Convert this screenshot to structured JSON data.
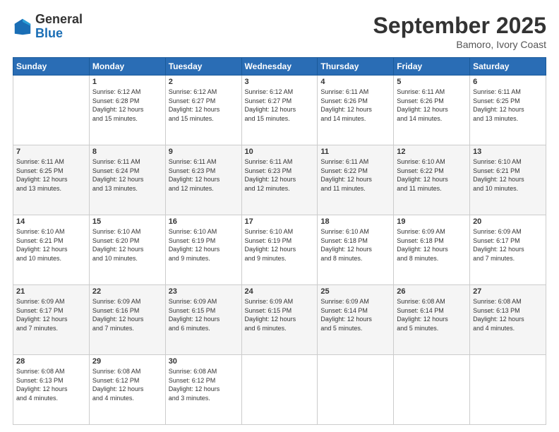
{
  "header": {
    "logo": {
      "line1": "General",
      "line2": "Blue"
    },
    "title": "September 2025",
    "location": "Bamoro, Ivory Coast"
  },
  "weekdays": [
    "Sunday",
    "Monday",
    "Tuesday",
    "Wednesday",
    "Thursday",
    "Friday",
    "Saturday"
  ],
  "weeks": [
    [
      {
        "day": "",
        "info": ""
      },
      {
        "day": "1",
        "info": "Sunrise: 6:12 AM\nSunset: 6:28 PM\nDaylight: 12 hours\nand 15 minutes."
      },
      {
        "day": "2",
        "info": "Sunrise: 6:12 AM\nSunset: 6:27 PM\nDaylight: 12 hours\nand 15 minutes."
      },
      {
        "day": "3",
        "info": "Sunrise: 6:12 AM\nSunset: 6:27 PM\nDaylight: 12 hours\nand 15 minutes."
      },
      {
        "day": "4",
        "info": "Sunrise: 6:11 AM\nSunset: 6:26 PM\nDaylight: 12 hours\nand 14 minutes."
      },
      {
        "day": "5",
        "info": "Sunrise: 6:11 AM\nSunset: 6:26 PM\nDaylight: 12 hours\nand 14 minutes."
      },
      {
        "day": "6",
        "info": "Sunrise: 6:11 AM\nSunset: 6:25 PM\nDaylight: 12 hours\nand 13 minutes."
      }
    ],
    [
      {
        "day": "7",
        "info": "Sunrise: 6:11 AM\nSunset: 6:25 PM\nDaylight: 12 hours\nand 13 minutes."
      },
      {
        "day": "8",
        "info": "Sunrise: 6:11 AM\nSunset: 6:24 PM\nDaylight: 12 hours\nand 13 minutes."
      },
      {
        "day": "9",
        "info": "Sunrise: 6:11 AM\nSunset: 6:23 PM\nDaylight: 12 hours\nand 12 minutes."
      },
      {
        "day": "10",
        "info": "Sunrise: 6:11 AM\nSunset: 6:23 PM\nDaylight: 12 hours\nand 12 minutes."
      },
      {
        "day": "11",
        "info": "Sunrise: 6:11 AM\nSunset: 6:22 PM\nDaylight: 12 hours\nand 11 minutes."
      },
      {
        "day": "12",
        "info": "Sunrise: 6:10 AM\nSunset: 6:22 PM\nDaylight: 12 hours\nand 11 minutes."
      },
      {
        "day": "13",
        "info": "Sunrise: 6:10 AM\nSunset: 6:21 PM\nDaylight: 12 hours\nand 10 minutes."
      }
    ],
    [
      {
        "day": "14",
        "info": "Sunrise: 6:10 AM\nSunset: 6:21 PM\nDaylight: 12 hours\nand 10 minutes."
      },
      {
        "day": "15",
        "info": "Sunrise: 6:10 AM\nSunset: 6:20 PM\nDaylight: 12 hours\nand 10 minutes."
      },
      {
        "day": "16",
        "info": "Sunrise: 6:10 AM\nSunset: 6:19 PM\nDaylight: 12 hours\nand 9 minutes."
      },
      {
        "day": "17",
        "info": "Sunrise: 6:10 AM\nSunset: 6:19 PM\nDaylight: 12 hours\nand 9 minutes."
      },
      {
        "day": "18",
        "info": "Sunrise: 6:10 AM\nSunset: 6:18 PM\nDaylight: 12 hours\nand 8 minutes."
      },
      {
        "day": "19",
        "info": "Sunrise: 6:09 AM\nSunset: 6:18 PM\nDaylight: 12 hours\nand 8 minutes."
      },
      {
        "day": "20",
        "info": "Sunrise: 6:09 AM\nSunset: 6:17 PM\nDaylight: 12 hours\nand 7 minutes."
      }
    ],
    [
      {
        "day": "21",
        "info": "Sunrise: 6:09 AM\nSunset: 6:17 PM\nDaylight: 12 hours\nand 7 minutes."
      },
      {
        "day": "22",
        "info": "Sunrise: 6:09 AM\nSunset: 6:16 PM\nDaylight: 12 hours\nand 7 minutes."
      },
      {
        "day": "23",
        "info": "Sunrise: 6:09 AM\nSunset: 6:15 PM\nDaylight: 12 hours\nand 6 minutes."
      },
      {
        "day": "24",
        "info": "Sunrise: 6:09 AM\nSunset: 6:15 PM\nDaylight: 12 hours\nand 6 minutes."
      },
      {
        "day": "25",
        "info": "Sunrise: 6:09 AM\nSunset: 6:14 PM\nDaylight: 12 hours\nand 5 minutes."
      },
      {
        "day": "26",
        "info": "Sunrise: 6:08 AM\nSunset: 6:14 PM\nDaylight: 12 hours\nand 5 minutes."
      },
      {
        "day": "27",
        "info": "Sunrise: 6:08 AM\nSunset: 6:13 PM\nDaylight: 12 hours\nand 4 minutes."
      }
    ],
    [
      {
        "day": "28",
        "info": "Sunrise: 6:08 AM\nSunset: 6:13 PM\nDaylight: 12 hours\nand 4 minutes."
      },
      {
        "day": "29",
        "info": "Sunrise: 6:08 AM\nSunset: 6:12 PM\nDaylight: 12 hours\nand 4 minutes."
      },
      {
        "day": "30",
        "info": "Sunrise: 6:08 AM\nSunset: 6:12 PM\nDaylight: 12 hours\nand 3 minutes."
      },
      {
        "day": "",
        "info": ""
      },
      {
        "day": "",
        "info": ""
      },
      {
        "day": "",
        "info": ""
      },
      {
        "day": "",
        "info": ""
      }
    ]
  ]
}
